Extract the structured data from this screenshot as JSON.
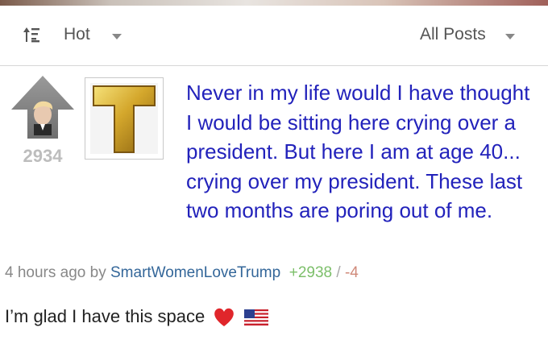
{
  "sortbar": {
    "sort_label": "Hot",
    "filter_label": "All Posts"
  },
  "post": {
    "score": "2934",
    "title": "Never in my life would I have thought I would be sitting here crying over a president. But here I am at age 40... crying over my president. These last two months are poring out of me.",
    "meta": {
      "time": "4 hours ago",
      "by": "by",
      "author": "SmartWomenLoveTrump",
      "upvotes": "+2938",
      "separator": "/",
      "downvotes": "-4"
    },
    "thumbnail_letter": "T"
  },
  "comment": {
    "text": "I’m glad I have this space"
  },
  "icons": {
    "sort": "sort-icon",
    "upvote": "upvote-arrow-icon",
    "heart": "red-heart-icon",
    "flag": "us-flag-icon"
  },
  "colors": {
    "title": "#2222bb",
    "author": "#336699",
    "upvotes": "#7cbf6a",
    "downvotes": "#d08a7a",
    "thumbnail_gold": "#d4a72c"
  }
}
